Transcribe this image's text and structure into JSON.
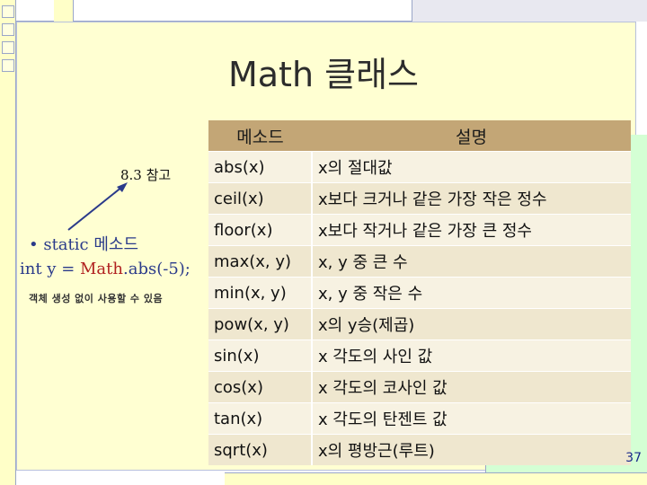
{
  "slide": {
    "title": "Math 클래스",
    "reference": "8.3 참고",
    "static_line": "• static 메소드",
    "code_prefix": "int y = ",
    "code_class": "Math",
    "code_suffix": ".abs(-5);",
    "note": "객체 생성 없이 사용할 수 있음",
    "page_number": "37"
  },
  "table": {
    "headers": [
      "메소드",
      "설명"
    ],
    "rows": [
      {
        "method": "abs(x)",
        "desc": "x의 절대값"
      },
      {
        "method": "ceil(x)",
        "desc": "x보다 크거나 같은 가장 작은 정수"
      },
      {
        "method": "floor(x)",
        "desc": "x보다 작거나 같은 가장 큰 정수"
      },
      {
        "method": "max(x, y)",
        "desc": "x, y 중 큰 수"
      },
      {
        "method": "min(x, y)",
        "desc": "x, y 중 작은 수"
      },
      {
        "method": "pow(x, y)",
        "desc": "x의 y승(제곱)"
      },
      {
        "method": "sin(x)",
        "desc": "x 각도의 사인 값"
      },
      {
        "method": "cos(x)",
        "desc": "x 각도의 코사인 값"
      },
      {
        "method": "tan(x)",
        "desc": "x 각도의 탄젠트 값"
      },
      {
        "method": "sqrt(x)",
        "desc": "x의 평방근(루트)"
      }
    ]
  },
  "colors": {
    "header_bg": "#c3a676",
    "text_blue": "#2a3a8a",
    "text_red": "#b02020"
  },
  "icons": [
    "arrow-icon"
  ]
}
